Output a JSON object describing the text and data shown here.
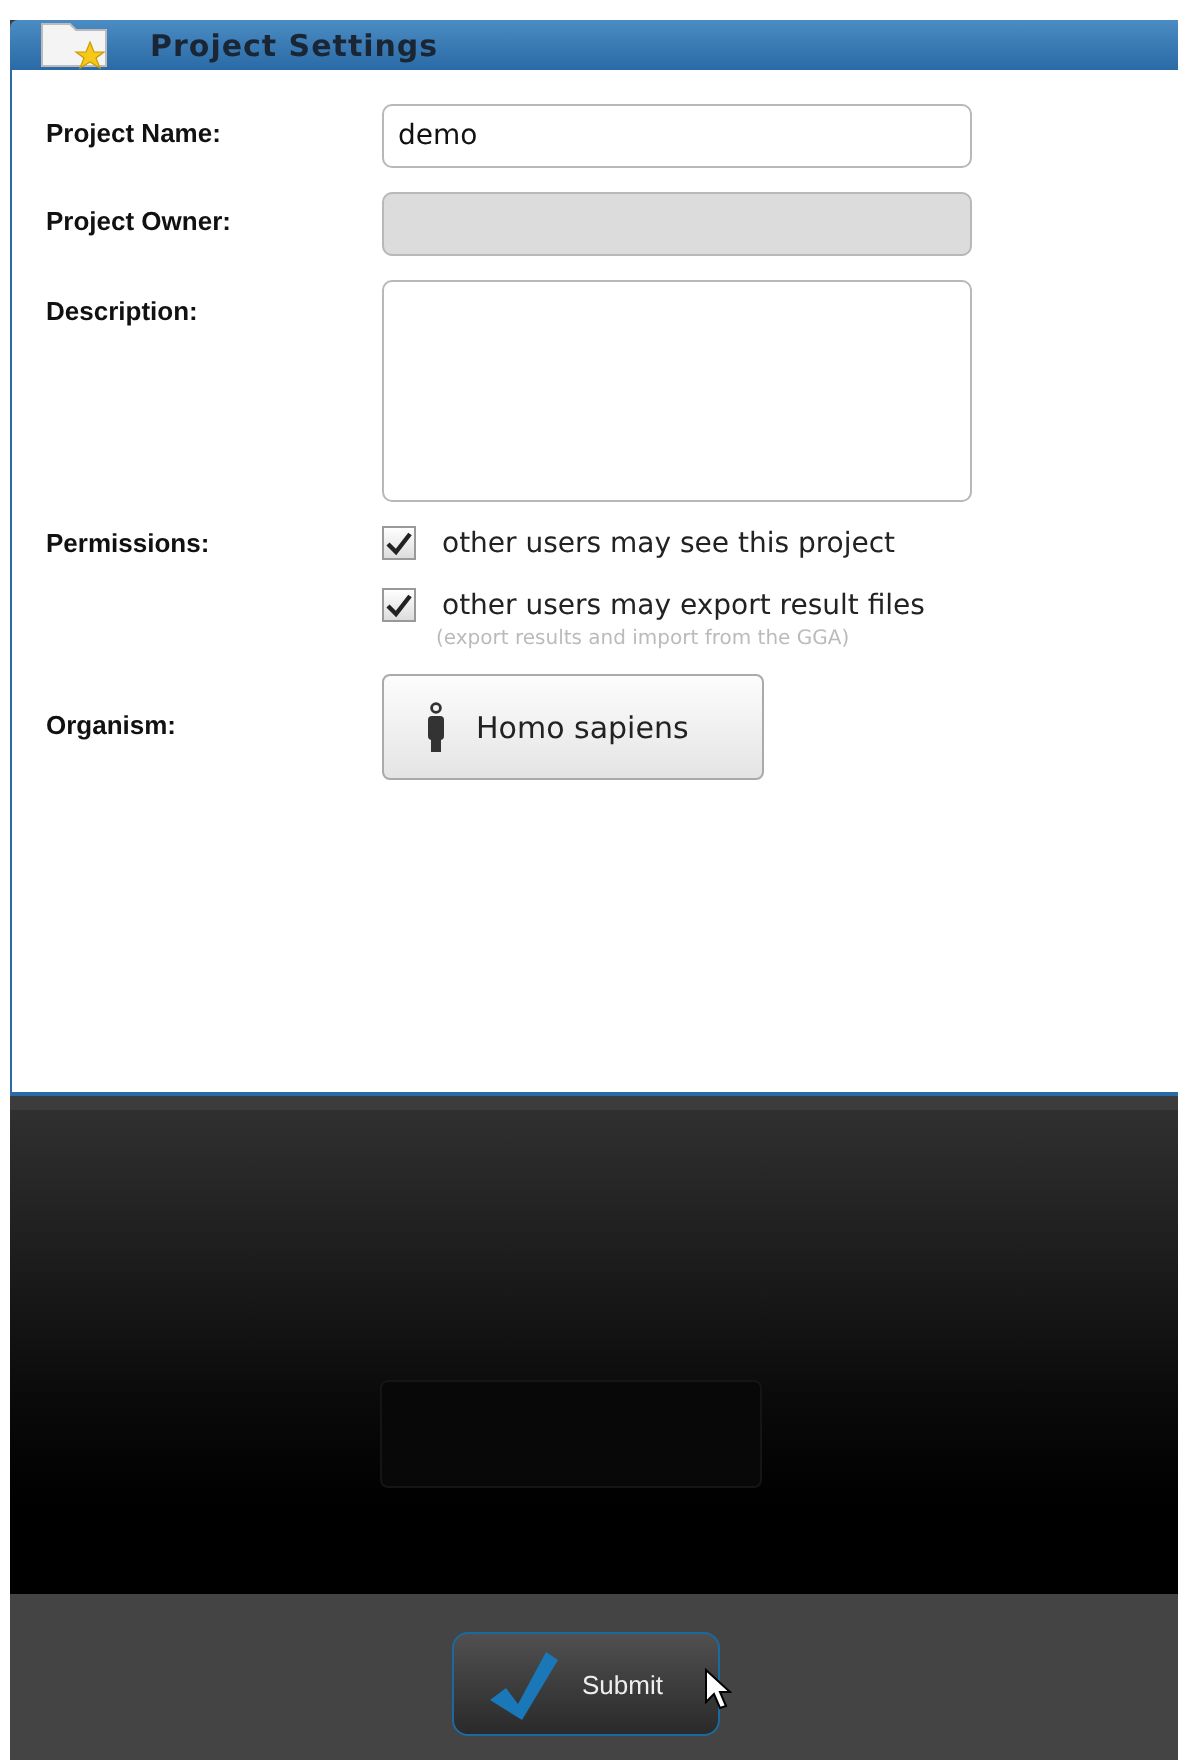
{
  "window": {
    "title": "Project Settings"
  },
  "fields": [
    {
      "label": "Project Name:",
      "kind": "text",
      "value": "demo",
      "disabled": false
    },
    {
      "label": "Project Owner:",
      "kind": "text",
      "disabled": true
    },
    {
      "label": "Description:",
      "kind": "textarea",
      "disabled": false
    }
  ],
  "permissions": {
    "label": "Permissions:",
    "options": [
      {
        "text": "other users may see this project",
        "checked": true
      },
      {
        "text": "other users may export result files",
        "checked": true
      }
    ],
    "hint": "(export results and import from the GGA)"
  },
  "organism": {
    "label": "Organism:",
    "button": "Homo sapiens"
  },
  "footer": {
    "button": "Submit"
  }
}
